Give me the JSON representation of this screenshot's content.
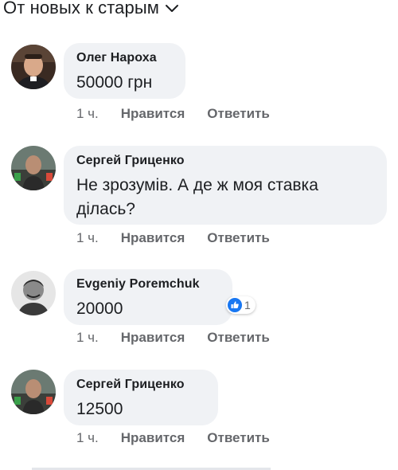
{
  "sort": {
    "label": "От новых к старым",
    "icon": "chevron-down-icon"
  },
  "colors": {
    "bubble": "#f0f2f5",
    "meta": "#65676b",
    "text": "#1c1e21",
    "like_blue": "#1877f2"
  },
  "comments": [
    {
      "author": "Олег Нароха",
      "text": "50000 грн",
      "time": "1 ч.",
      "like_label": "Нравится",
      "reply_label": "Ответить"
    },
    {
      "author": "Сергей Гриценко",
      "text": "Не зрозумів. А де ж моя ставка ділась?",
      "time": "1 ч.",
      "like_label": "Нравится",
      "reply_label": "Ответить"
    },
    {
      "author": "Evgeniy Poremchuk",
      "text": "20000",
      "time": "1 ч.",
      "like_label": "Нравится",
      "reply_label": "Ответить",
      "reaction": {
        "icon": "like-icon",
        "count": "1"
      }
    },
    {
      "author": "Сергей Гриценко",
      "text": "12500",
      "time": "1 ч.",
      "like_label": "Нравится",
      "reply_label": "Ответить"
    }
  ]
}
